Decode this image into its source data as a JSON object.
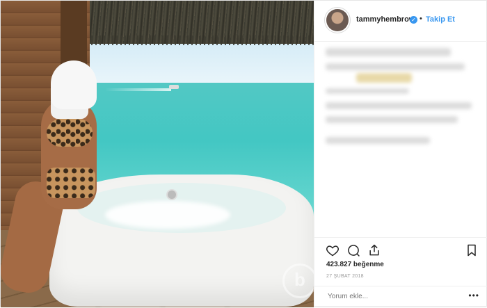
{
  "header": {
    "username": "tammyhembrow",
    "separator": "•",
    "follow_label": "Takip Et"
  },
  "caption": {
    "blurred": true
  },
  "actions": {
    "like_icon": "heart-icon",
    "comment_icon": "comment-icon",
    "share_icon": "share-icon",
    "save_icon": "bookmark-icon"
  },
  "likes_text": "423.827 beğenme",
  "date_text": "27 ŞUBAT 2018",
  "comment": {
    "placeholder": "Yorum ekle...",
    "more_label": "•••"
  },
  "colors": {
    "accent": "#3897f0",
    "text": "#262626",
    "muted": "#999999"
  }
}
